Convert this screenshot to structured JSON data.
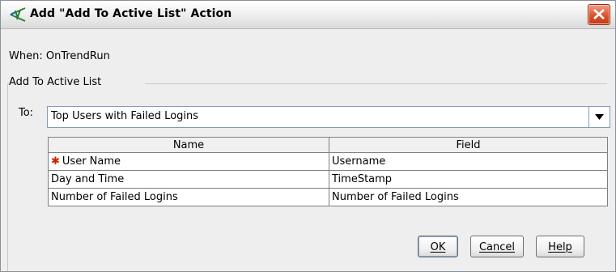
{
  "window": {
    "title": "Add \"Add To Active List\" Action",
    "icon": "trend-action-icon",
    "close_icon": "close-icon"
  },
  "when_text": "When: OnTrendRun",
  "group_title": "Add To Active List",
  "to_label": "To:",
  "to_select": {
    "value": "Top Users with Failed Logins",
    "arrow_icon": "dropdown-arrow-icon"
  },
  "table": {
    "columns": [
      "Name",
      "Field"
    ],
    "rows": [
      {
        "name": "User Name",
        "field": "Username",
        "required": true
      },
      {
        "name": "Day and Time",
        "field": "TimeStamp",
        "required": false
      },
      {
        "name": "Number of Failed Logins",
        "field": "Number of Failed Logins",
        "required": false
      }
    ],
    "required_marker": "✱"
  },
  "buttons": {
    "ok": "OK",
    "cancel": "Cancel",
    "help": "Help"
  },
  "colors": {
    "close_button": "#d9532e",
    "required_marker": "#cc2200",
    "field_border": "#7f9db9"
  }
}
